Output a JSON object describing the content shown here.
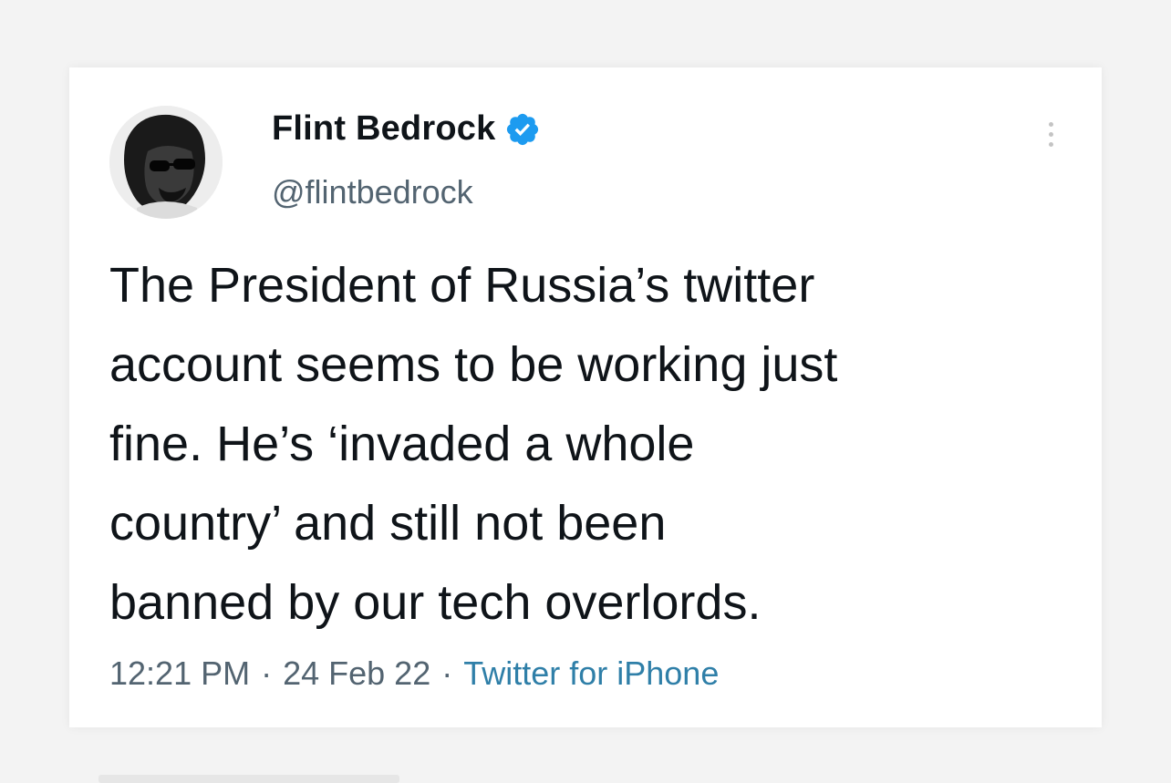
{
  "tweet": {
    "author_name": "Flint Bedrock",
    "author_handle": "@flintbedrock",
    "verified_icon": "verified-badge-icon",
    "more_icon": "more-options-icon",
    "text": "The President of Russia’s twitter\naccount seems to be working just\nfine. He’s ‘invaded a whole\ncountry’ and still not been\nbanned by our tech overlords.",
    "time": "12:21 PM",
    "separator": "·",
    "date": "24 Feb 22",
    "source": "Twitter for iPhone"
  },
  "colors": {
    "text_primary": "#0f1419",
    "text_secondary": "#536471",
    "source_link": "#2f7fa8",
    "verified": "#1d9bf0"
  }
}
